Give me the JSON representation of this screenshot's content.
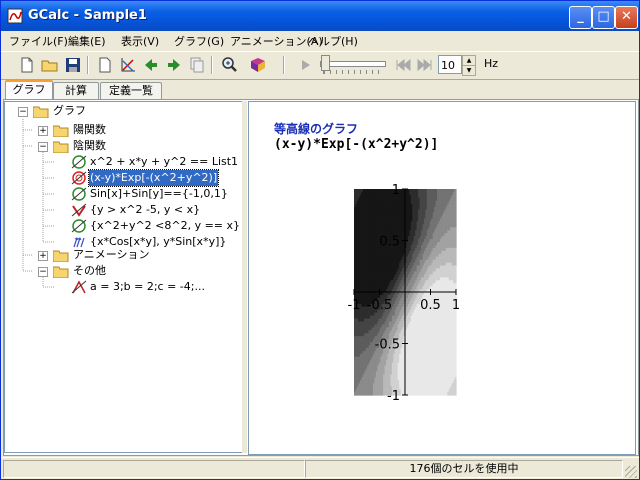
{
  "window": {
    "title": "GCalc - Sample1"
  },
  "menu": [
    "ファイル(F)",
    "編集(E)",
    "表示(V)",
    "グラフ(G)",
    "アニメーション(A)",
    "ヘルプ(H)"
  ],
  "toolbar": {
    "frequency_value": "10",
    "frequency_unit": "Hz"
  },
  "tabs": [
    "グラフ",
    "計算",
    "定義一覧"
  ],
  "tree": {
    "root": "グラフ",
    "explicit": "陽関数",
    "implicit": "陰関数",
    "implicit_items": [
      "x^2 + x*y + y^2 == List1",
      "(x-y)*Exp[-(x^2+y^2)]",
      "Sin[x]+Sin[y]=={-1,0,1}",
      "{y > x^2 -5, y < x}",
      "{x^2+y^2 <8^2, y == x}",
      "{x*Cos[x*y], y*Sin[x*y]}"
    ],
    "animation": "アニメーション",
    "other": "その他",
    "other_items": [
      "a = 3;b = 2;c = -4;..."
    ]
  },
  "graph": {
    "title": "等高線のグラフ",
    "expression": "(x-y)*Exp[-(x^2+y^2)]",
    "x_ticks": [
      "-1",
      "-0.5",
      "0.5",
      "1"
    ],
    "y_ticks": [
      "1",
      "0.5",
      "-0.5",
      "-1"
    ]
  },
  "chart_data": {
    "type": "heatmap",
    "function": "(x-y)*Exp[-(x^2+y^2)]",
    "xlim": [
      -1,
      1
    ],
    "ylim": [
      -1,
      1
    ],
    "levels": 10,
    "colormap": "grayscale (dark = low, light = high)"
  },
  "status": {
    "message": "176個のセルを使用中"
  }
}
